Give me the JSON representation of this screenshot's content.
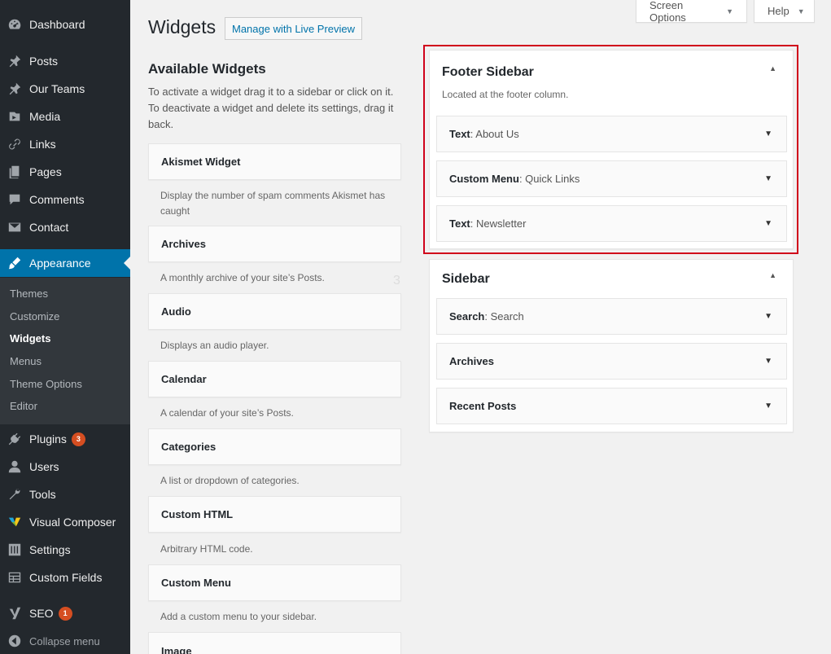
{
  "menu": {
    "dashboard": "Dashboard",
    "posts": "Posts",
    "our_teams": "Our Teams",
    "media": "Media",
    "links": "Links",
    "pages": "Pages",
    "comments": "Comments",
    "contact": "Contact",
    "appearance": "Appearance",
    "plugins": "Plugins",
    "plugins_badge": "3",
    "users": "Users",
    "tools": "Tools",
    "visual_composer": "Visual Composer",
    "settings": "Settings",
    "custom_fields": "Custom Fields",
    "seo": "SEO",
    "seo_badge": "1",
    "collapse": "Collapse menu"
  },
  "submenu": {
    "themes": "Themes",
    "customize": "Customize",
    "widgets": "Widgets",
    "menus": "Menus",
    "theme_options": "Theme Options",
    "editor": "Editor"
  },
  "header": {
    "screen_options": "Screen Options",
    "help": "Help",
    "title": "Widgets",
    "live_preview": "Manage with Live Preview"
  },
  "available": {
    "title": "Available Widgets",
    "description": "To activate a widget drag it to a sidebar or click on it. To deactivate a widget and delete its settings, drag it back.",
    "widgets": [
      {
        "name": "Akismet Widget",
        "desc": "Display the number of spam comments Akismet has caught"
      },
      {
        "name": "Archives",
        "desc": "A monthly archive of your site’s Posts."
      },
      {
        "name": "Audio",
        "desc": "Displays an audio player."
      },
      {
        "name": "Calendar",
        "desc": "A calendar of your site’s Posts."
      },
      {
        "name": "Categories",
        "desc": "A list or dropdown of categories."
      },
      {
        "name": "Custom HTML",
        "desc": "Arbitrary HTML code."
      },
      {
        "name": "Custom Menu",
        "desc": "Add a custom menu to your sidebar."
      },
      {
        "name": "Image",
        "desc": ""
      }
    ]
  },
  "ghost_number": "3",
  "footer_sidebar": {
    "title": "Footer Sidebar",
    "description": "Located at the footer column.",
    "widgets": [
      {
        "type": "Text",
        "name": ": About Us"
      },
      {
        "type": "Custom Menu",
        "name": ": Quick Links"
      },
      {
        "type": "Text",
        "name": ": Newsletter"
      }
    ]
  },
  "sidebar": {
    "title": "Sidebar",
    "widgets": [
      {
        "type": "Search",
        "name": ": Search"
      },
      {
        "type": "Archives",
        "name": ""
      },
      {
        "type": "Recent Posts",
        "name": ""
      }
    ]
  },
  "colors": {
    "admin_menu_bg": "#23282d",
    "submenu_bg": "#32373c",
    "accent": "#0073aa",
    "badge": "#d54e21",
    "highlight": "#d0021b"
  }
}
